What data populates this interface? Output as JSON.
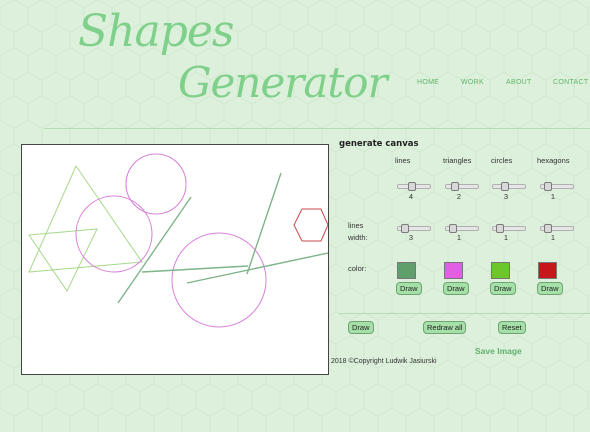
{
  "logo": {
    "line1": "Shapes",
    "line2": "Generator"
  },
  "nav": [
    "HOME",
    "WORK",
    "ABOUT",
    "CONTACT"
  ],
  "panel": {
    "title": "generate canvas",
    "columns": [
      "lines",
      "triangles",
      "circles",
      "hexagons"
    ],
    "count_values": [
      "4",
      "2",
      "3",
      "1"
    ],
    "width_label_1": "lines",
    "width_label_2": "width:",
    "width_values": [
      "3",
      "1",
      "1",
      "1"
    ],
    "color_label": "color:",
    "colors": [
      "#5e9f6b",
      "#e15fe0",
      "#6ec72a",
      "#c6171c"
    ],
    "draw_label": "Draw"
  },
  "actions": {
    "draw": "Draw",
    "redraw_all": "Redraw all",
    "reset": "Reset",
    "save_image": "Save Image"
  },
  "footer": {
    "copyright": "2018 ©Copyright Ludwik Jasiurski"
  }
}
